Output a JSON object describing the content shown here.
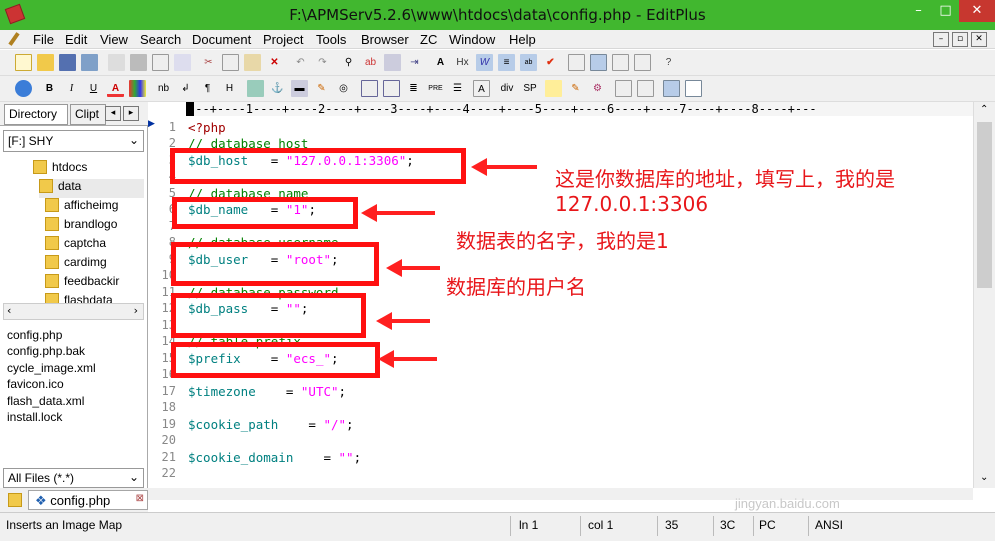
{
  "window": {
    "title": "F:\\APMServ5.2.6\\www\\htdocs\\data\\config.php - EditPlus",
    "min": "–",
    "max": "□",
    "close": "✕"
  },
  "menu": [
    "File",
    "Edit",
    "View",
    "Search",
    "Document",
    "Project",
    "Tools",
    "Browser",
    "ZC",
    "Window",
    "Help"
  ],
  "toolbar2_labels": {
    "bold": "B",
    "italic": "I",
    "underline": "U",
    "font": "A",
    "nb": "nb",
    "para": "¶",
    "hr": "H",
    "div": "div",
    "sp": "SP",
    "hx": "Hx"
  },
  "sidebar": {
    "tab_directory": "Directory",
    "tab_clip": "Clipt",
    "drive": "[F:] SHY",
    "tree": [
      "htdocs",
      "data",
      "afficheimg",
      "brandlogo",
      "captcha",
      "cardimg",
      "feedbackir",
      "flashdata"
    ],
    "files": [
      "config.php",
      "config.php.bak",
      "cycle_image.xml",
      "favicon.ico",
      "flash_data.xml",
      "install.lock"
    ],
    "filter": "All Files (*.*)"
  },
  "editor": {
    "ruler": "---+----1----+----2----+----3----+----4----+----5----+----6----+----7----+----8----+---",
    "line_numbers": [
      "1",
      "2",
      "3",
      "4",
      "5",
      "6",
      "7",
      "8",
      "9",
      "10",
      "11",
      "12",
      "13",
      "14",
      "15",
      "16",
      "17",
      "18",
      "19",
      "20",
      "21",
      "22"
    ],
    "code": {
      "l1": "<?php",
      "l2": "// database host",
      "l3a": "$db_host",
      "l3b": "   = ",
      "l3c": "\"127.0.0.1:3306\"",
      "l3d": ";",
      "l5": "// database name",
      "l6a": "$db_name",
      "l6b": "   = ",
      "l6c": "\"1\"",
      "l6d": ";",
      "l8": "// database username",
      "l9a": "$db_user",
      "l9b": "   = ",
      "l9c": "\"root\"",
      "l9d": ";",
      "l11": "// database password",
      "l12a": "$db_pass",
      "l12b": "   = ",
      "l12c": "\"\"",
      "l12d": ";",
      "l14": "// table prefix",
      "l15a": "$prefix",
      "l15b": "    = ",
      "l15c": "\"ecs_\"",
      "l15d": ";",
      "l17a": "$timezone",
      "l17b": "    = ",
      "l17c": "\"UTC\"",
      "l17d": ";",
      "l19a": "$cookie_path",
      "l19b": "    = ",
      "l19c": "\"/\"",
      "l19d": ";",
      "l21a": "$cookie_domain",
      "l21b": "    = ",
      "l21c": "\"\"",
      "l21d": ";"
    }
  },
  "annotations": {
    "a1": "这是你数据库的地址，填写上，我的是",
    "a1b": "127.0.0.1:3306",
    "a2": "数据表的名字，我的是1",
    "a3": "数据库的用户名"
  },
  "doc_tab": "config.php",
  "status": {
    "hint": "Inserts an Image Map",
    "ln": "ln 1",
    "col": "col 1",
    "n35": "35",
    "h3c": "3C",
    "pc": "PC",
    "enc": "ANSI"
  },
  "watermark": "jingyan.baidu.com",
  "colors": {
    "titlebar": "#41b72f",
    "comment": "#008000",
    "variable": "#008080",
    "string": "#ff00ff",
    "annotation": "#e8161a"
  }
}
